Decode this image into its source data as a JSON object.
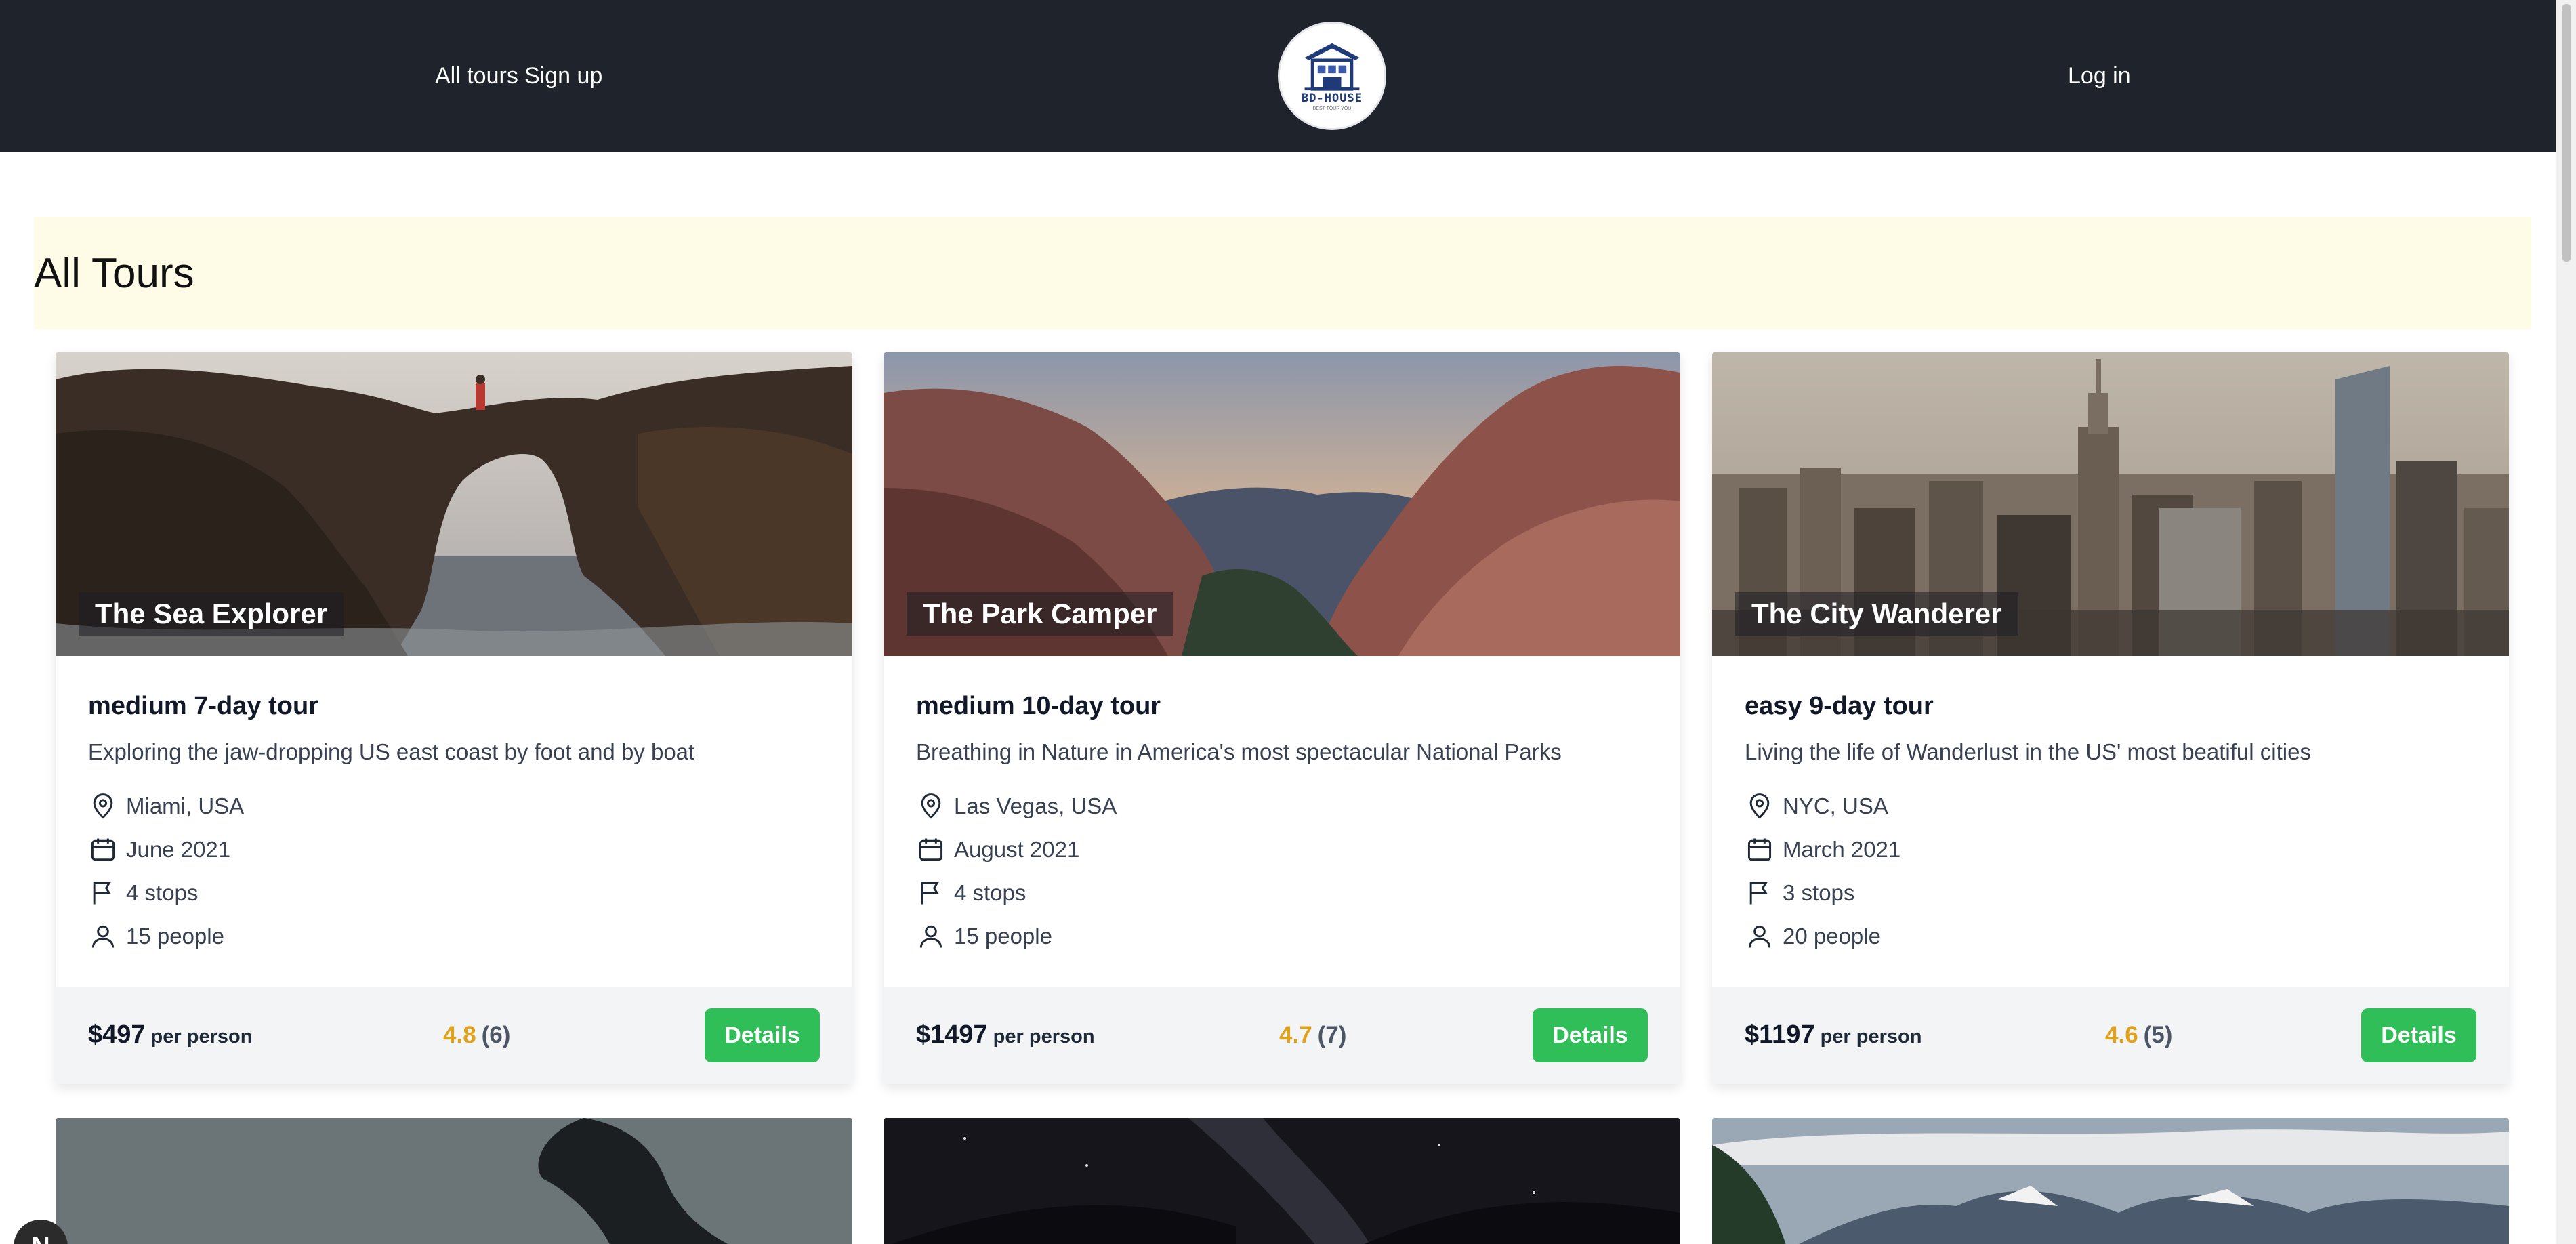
{
  "header": {
    "nav_all_tours": "All tours",
    "nav_sign_up": "Sign up",
    "nav_log_in": "Log in",
    "logo_text": "BD-HOUSE",
    "logo_tagline": "BEST TOUR YOU"
  },
  "page": {
    "heading": "All Tours"
  },
  "tours": [
    {
      "name": "The Sea Explorer",
      "summary": "medium 7-day tour",
      "description": "Exploring the jaw-dropping US east coast by foot and by boat",
      "location": "Miami, USA",
      "date": "June 2021",
      "stops": "4 stops",
      "people": "15 people",
      "price": "$497",
      "per": "per person",
      "rating": "4.8",
      "rating_count": "(6)",
      "button": "Details"
    },
    {
      "name": "The Park Camper",
      "summary": "medium 10-day tour",
      "description": "Breathing in Nature in America's most spectacular National Parks",
      "location": "Las Vegas, USA",
      "date": "August 2021",
      "stops": "4 stops",
      "people": "15 people",
      "price": "$1497",
      "per": "per person",
      "rating": "4.7",
      "rating_count": "(7)",
      "button": "Details"
    },
    {
      "name": "The City Wanderer",
      "summary": "easy 9-day tour",
      "description": "Living the life of Wanderlust in the US' most beatiful cities",
      "location": "NYC, USA",
      "date": "March 2021",
      "stops": "3 stops",
      "people": "20 people",
      "price": "$1197",
      "per": "per person",
      "rating": "4.6",
      "rating_count": "(5)",
      "button": "Details"
    }
  ],
  "icons": {
    "location": "map-pin-icon",
    "date": "calendar-icon",
    "stops": "flag-icon",
    "people": "user-icon"
  },
  "widgets": {
    "chat_bubble": "N"
  },
  "colors": {
    "header_bg": "#1f232b",
    "banner_bg": "#fefbe6",
    "button_green": "#2fbe57",
    "rating_gold": "#e0a11b",
    "footer_bg": "#f3f4f6"
  }
}
